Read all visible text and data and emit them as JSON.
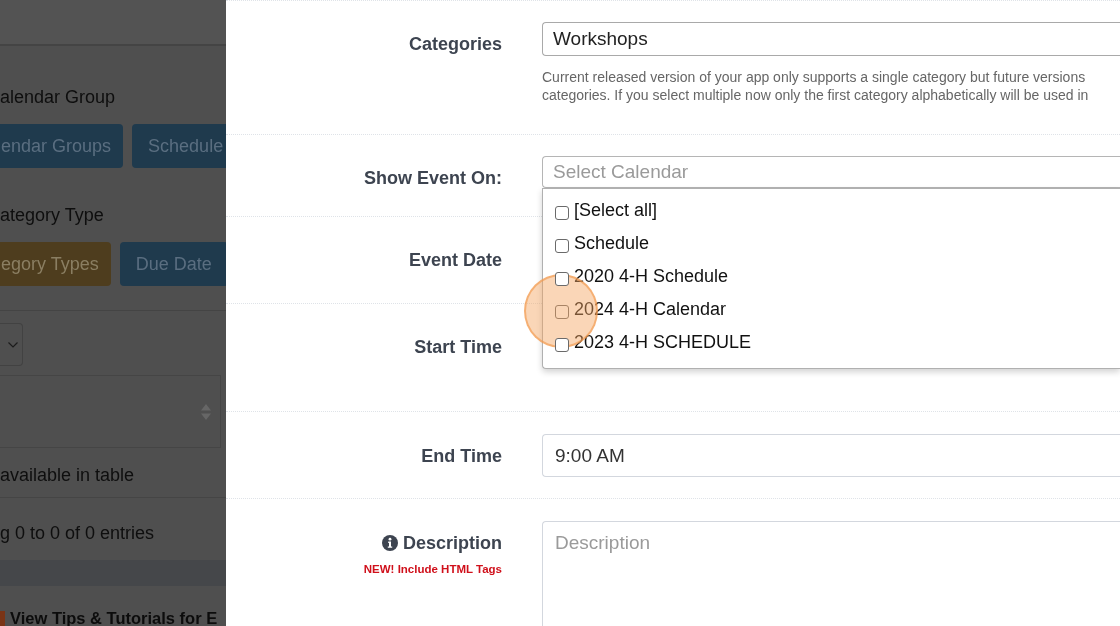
{
  "background_page": {
    "sections": [
      {
        "heading": "alendar Group",
        "buttons": [
          {
            "label": "endar Groups",
            "kind": "primary"
          },
          {
            "label": "Schedule",
            "kind": "primary"
          }
        ]
      },
      {
        "heading": "ategory Type",
        "buttons": [
          {
            "label": "egory Types",
            "kind": "warning"
          },
          {
            "label": "Due Date",
            "kind": "primary"
          }
        ]
      }
    ],
    "table": {
      "empty_message": "available in table",
      "info": "g 0 to 0 of 0 entries"
    },
    "tips_link": "View Tips & Tutorials for E"
  },
  "form": {
    "rows": [
      {
        "kind": "select",
        "label": "Categories",
        "value": "Workshops",
        "help_lines": [
          "Current released version of your app only supports a single category but future versions",
          "categories. If you select multiple now only the first category alphabetically will be used in"
        ]
      },
      {
        "kind": "multiselect",
        "label": "Show Event On:",
        "placeholder": "Select Calendar",
        "dropdown": {
          "options": [
            {
              "label": "[Select all]",
              "checked": false,
              "clicked": false
            },
            {
              "label": "Schedule",
              "checked": false,
              "clicked": false
            },
            {
              "label": "2020 4-H Schedule",
              "checked": false,
              "clicked": false
            },
            {
              "label": "2024 4-H Calendar",
              "checked": false,
              "clicked": true
            },
            {
              "label": "2023 4-H SCHEDULE",
              "checked": false,
              "clicked": false
            }
          ]
        }
      },
      {
        "kind": "covered",
        "label": "Event Date"
      },
      {
        "kind": "covered",
        "label": "Start Time"
      },
      {
        "kind": "text",
        "label": "End Time",
        "value": "9:00 AM"
      },
      {
        "kind": "textarea",
        "label": "Description",
        "info_icon": true,
        "note": "NEW! Include HTML Tags",
        "placeholder": "Description"
      }
    ]
  }
}
